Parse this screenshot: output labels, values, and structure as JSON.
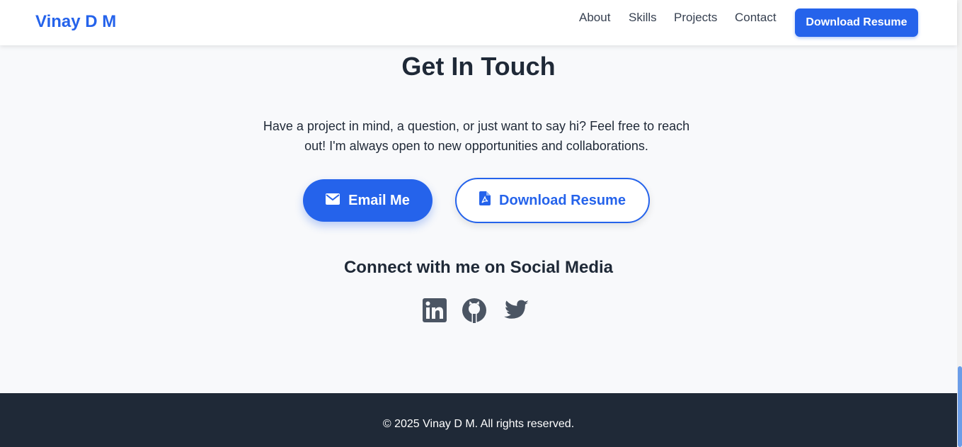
{
  "header": {
    "brand": "Vinay D M",
    "nav": [
      "About",
      "Skills",
      "Projects",
      "Contact"
    ],
    "resume_button": "Download Resume"
  },
  "contact": {
    "title": "Get In Touch",
    "intro_line1": "Have a project in mind, a question, or just want to say hi? Feel free to reach",
    "intro_line2": "out! I'm always open to new opportunities and collaborations.",
    "email_button": "Email Me",
    "resume_button": "Download Resume",
    "social_title": "Connect with me on Social Media",
    "social_icons": [
      "linkedin-icon",
      "github-icon",
      "twitter-icon"
    ]
  },
  "footer": {
    "copyright": "© 2025 Vinay D M. All rights reserved."
  },
  "colors": {
    "accent": "#2563eb",
    "text": "#1f2937",
    "background": "#f8f9fb",
    "footer": "#1f2937",
    "icon": "#4b5563"
  }
}
